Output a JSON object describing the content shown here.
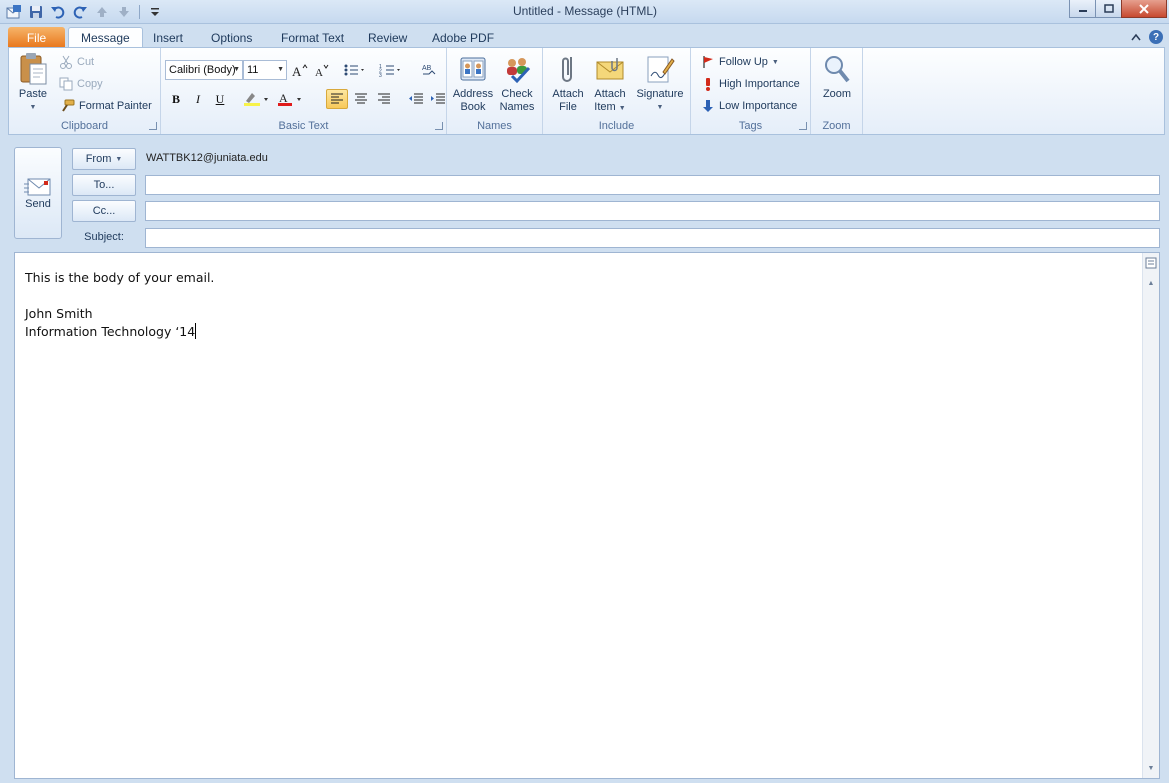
{
  "window": {
    "title": "Untitled  -  Message (HTML)"
  },
  "tabs": [
    {
      "label": "File"
    },
    {
      "label": "Message"
    },
    {
      "label": "Insert"
    },
    {
      "label": "Options"
    },
    {
      "label": "Format Text"
    },
    {
      "label": "Review"
    },
    {
      "label": "Adobe PDF"
    }
  ],
  "ribbon": {
    "clipboard": {
      "label": "Clipboard",
      "paste": "Paste",
      "cut": "Cut",
      "copy": "Copy",
      "format_painter": "Format Painter"
    },
    "basic_text": {
      "label": "Basic Text",
      "font": "Calibri (Body)",
      "size": "11",
      "bold": "B",
      "italic": "I",
      "underline": "U"
    },
    "names": {
      "label": "Names",
      "address_book_1": "Address",
      "address_book_2": "Book",
      "check_names_1": "Check",
      "check_names_2": "Names"
    },
    "include": {
      "label": "Include",
      "attach_file_1": "Attach",
      "attach_file_2": "File",
      "attach_item_1": "Attach",
      "attach_item_2": "Item",
      "signature": "Signature"
    },
    "tags": {
      "label": "Tags",
      "follow_up": "Follow Up",
      "high": "High Importance",
      "low": "Low Importance"
    },
    "zoom": {
      "label": "Zoom",
      "zoom": "Zoom"
    }
  },
  "compose": {
    "send": "Send",
    "from": "From",
    "from_address": "WATTBK12@juniata.edu",
    "to": "To...",
    "cc": "Cc...",
    "subject": "Subject:",
    "to_value": "",
    "cc_value": "",
    "subject_value": ""
  },
  "body": {
    "line1": "This is the body of your email.",
    "line2": "John Smith",
    "line3": "Information Technology ‘14"
  },
  "colors": {
    "accent": "#e8751a",
    "ribbon_border": "#a9c1dd",
    "highlight": "#f8c95a"
  }
}
